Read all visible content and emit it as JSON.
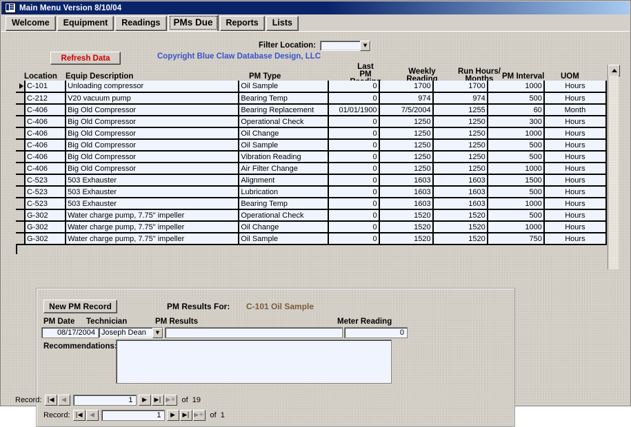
{
  "window": {
    "title": "Main Menu Version 8/10/04",
    "icon": "access-form-icon"
  },
  "tabs": [
    {
      "label": "Welcome",
      "active": false
    },
    {
      "label": "Equipment",
      "active": false
    },
    {
      "label": "Readings",
      "active": false
    },
    {
      "label": "PMs Due",
      "active": true
    },
    {
      "label": "Reports",
      "active": false
    },
    {
      "label": "Lists",
      "active": false
    }
  ],
  "filter": {
    "label": "Filter Location:",
    "value": "",
    "arrow_icon": "chevron-down-icon"
  },
  "toolbar": {
    "refresh_label": "Refresh Data",
    "copyright": "Copyright Blue Claw Database Design, LLC",
    "refresh_color": "#d00000",
    "copyright_color": "#3a52c8"
  },
  "grid": {
    "columns": [
      {
        "key": "location",
        "label": "Location"
      },
      {
        "key": "equip",
        "label": "Equip Description"
      },
      {
        "key": "pmtype",
        "label": "PM Type"
      },
      {
        "key": "lastpm",
        "label": "Last\nPM\nReading"
      },
      {
        "key": "weekly",
        "label": "Weekly\nReading"
      },
      {
        "key": "runhours",
        "label": "Run Hours/\nMonths"
      },
      {
        "key": "interval",
        "label": "PM Interval"
      },
      {
        "key": "uom",
        "label": "UOM"
      }
    ],
    "header_lines": {
      "location": [
        "Location"
      ],
      "equip": [
        "Equip Description"
      ],
      "pmtype": [
        "PM Type"
      ],
      "lastpm": [
        "Last",
        "PM",
        "Reading"
      ],
      "weekly": [
        "Weekly",
        "Reading"
      ],
      "runhours": [
        "Run Hours/",
        "Months"
      ],
      "interval": [
        "PM Interval"
      ],
      "uom": [
        "UOM"
      ]
    },
    "rows": [
      {
        "current": true,
        "location": "C-101",
        "equip": "Unloading compressor",
        "pmtype": "Oil Sample",
        "lastpm": "0",
        "weekly": "1700",
        "runhours": "1700",
        "interval": "1000",
        "uom": "Hours"
      },
      {
        "current": false,
        "location": "C-212",
        "equip": "V20 vacuum pump",
        "pmtype": "Bearing Temp",
        "lastpm": "0",
        "weekly": "974",
        "runhours": "974",
        "interval": "500",
        "uom": "Hours"
      },
      {
        "current": false,
        "location": "C-406",
        "equip": "Big Old Compressor",
        "pmtype": "Bearing Replacement",
        "lastpm": "01/01/1900",
        "weekly": "7/5/2004",
        "runhours": "1255",
        "interval": "60",
        "uom": "Month"
      },
      {
        "current": false,
        "location": "C-406",
        "equip": "Big Old Compressor",
        "pmtype": "Operational Check",
        "lastpm": "0",
        "weekly": "1250",
        "runhours": "1250",
        "interval": "300",
        "uom": "Hours"
      },
      {
        "current": false,
        "location": "C-406",
        "equip": "Big Old Compressor",
        "pmtype": "Oil Change",
        "lastpm": "0",
        "weekly": "1250",
        "runhours": "1250",
        "interval": "1000",
        "uom": "Hours"
      },
      {
        "current": false,
        "location": "C-406",
        "equip": "Big Old Compressor",
        "pmtype": "Oil Sample",
        "lastpm": "0",
        "weekly": "1250",
        "runhours": "1250",
        "interval": "500",
        "uom": "Hours"
      },
      {
        "current": false,
        "location": "C-406",
        "equip": "Big Old Compressor",
        "pmtype": "Vibration Reading",
        "lastpm": "0",
        "weekly": "1250",
        "runhours": "1250",
        "interval": "500",
        "uom": "Hours"
      },
      {
        "current": false,
        "location": "C-406",
        "equip": "Big Old Compressor",
        "pmtype": "Air Filter Change",
        "lastpm": "0",
        "weekly": "1250",
        "runhours": "1250",
        "interval": "1000",
        "uom": "Hours"
      },
      {
        "current": false,
        "location": "C-523",
        "equip": "503 Exhauster",
        "pmtype": "Alignment",
        "lastpm": "0",
        "weekly": "1603",
        "runhours": "1603",
        "interval": "1500",
        "uom": "Hours"
      },
      {
        "current": false,
        "location": "C-523",
        "equip": "503 Exhauster",
        "pmtype": "Lubrication",
        "lastpm": "0",
        "weekly": "1603",
        "runhours": "1603",
        "interval": "500",
        "uom": "Hours"
      },
      {
        "current": false,
        "location": "C-523",
        "equip": "503 Exhauster",
        "pmtype": "Bearing Temp",
        "lastpm": "0",
        "weekly": "1603",
        "runhours": "1603",
        "interval": "1000",
        "uom": "Hours"
      },
      {
        "current": false,
        "location": "G-302",
        "equip": "Water charge pump, 7.75\" impeller",
        "pmtype": "Operational Check",
        "lastpm": "0",
        "weekly": "1520",
        "runhours": "1520",
        "interval": "500",
        "uom": "Hours"
      },
      {
        "current": false,
        "location": "G-302",
        "equip": "Water charge pump, 7.75\" impeller",
        "pmtype": "Oil Change",
        "lastpm": "0",
        "weekly": "1520",
        "runhours": "1520",
        "interval": "1000",
        "uom": "Hours"
      },
      {
        "current": false,
        "location": "G-302",
        "equip": "Water charge pump, 7.75\" impeller",
        "pmtype": "Oil Sample",
        "lastpm": "0",
        "weekly": "1520",
        "runhours": "1520",
        "interval": "750",
        "uom": "Hours"
      }
    ],
    "scrollbar": {
      "up_icon": "scroll-up-icon"
    }
  },
  "subform": {
    "new_record_label": "New PM Record",
    "results_for_label": "PM Results For:",
    "results_for_value": "C-101 Oil Sample",
    "headers": {
      "pm_date": "PM Date",
      "technician": "Technician",
      "pm_results": "PM Results",
      "meter_reading": "Meter Reading",
      "recommendations": "Recommendations:"
    },
    "fields": {
      "pm_date": "08/17/2004",
      "technician": "Joseph Dean",
      "pm_results": "",
      "meter_reading": "0",
      "recommendations": ""
    },
    "nav": {
      "label": "Record:",
      "value": "1",
      "of_label": "of",
      "total": "1",
      "first_icon": "nav-first-icon",
      "prev_icon": "nav-prev-icon",
      "next_icon": "nav-next-icon",
      "last_icon": "nav-last-icon",
      "new_icon": "nav-new-icon"
    }
  },
  "main_nav": {
    "label": "Record:",
    "value": "1",
    "of_label": "of",
    "total": "19",
    "first_icon": "nav-first-icon",
    "prev_icon": "nav-prev-icon",
    "next_icon": "nav-next-icon",
    "last_icon": "nav-last-icon",
    "new_icon": "nav-new-icon"
  }
}
